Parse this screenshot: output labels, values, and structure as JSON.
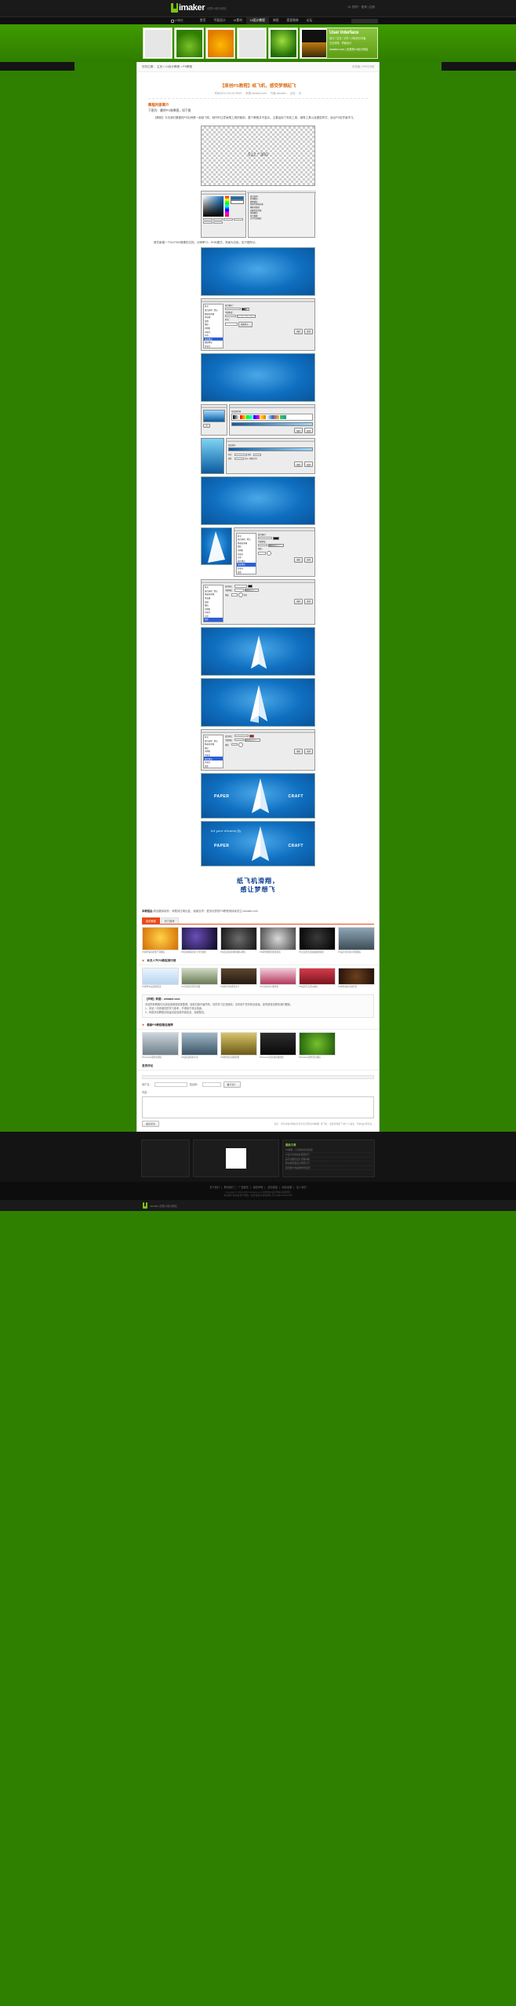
{
  "site": {
    "logo_word": "imaker",
    "logo_sub": "优秀UI设计网站",
    "top_right_greeting": "Hi, 您好！ 登录 | 注册"
  },
  "nav": {
    "home_label": "UI首页",
    "items": [
      {
        "label": "首页",
        "active": false
      },
      {
        "label": "平面设计",
        "active": false
      },
      {
        "label": "UI素材",
        "active": false
      },
      {
        "label": "UI设计教程",
        "active": true
      },
      {
        "label": "体验",
        "active": false
      },
      {
        "label": "家居装修",
        "active": false
      },
      {
        "label": "论坛",
        "active": false
      }
    ],
    "search_placeholder": "搜索"
  },
  "banner": {
    "thumbs": [
      {
        "name": "blank-thumb",
        "kind": "blank"
      },
      {
        "name": "leaf-thumb",
        "kind": "leaf"
      },
      {
        "name": "pepper-thumb",
        "kind": "pepper"
      },
      {
        "name": "blank2-thumb",
        "kind": "blank"
      },
      {
        "name": "apple-thumb",
        "kind": "apple"
      },
      {
        "name": "city-thumb",
        "kind": "city"
      }
    ],
    "promo": {
      "title": "User Interface",
      "desc": "设计 / 交互 / 分享 • UI知识分享者",
      "site": "uimaker.com | 优秀的UI设计网站",
      "sub": "交互体验 · 界面设计"
    }
  },
  "breadcrumb": {
    "prefix": "您的位置：",
    "items": [
      "主页",
      "UI设计教程",
      "PS教程"
    ],
    "right": "手机版 | RSS订阅"
  },
  "article": {
    "title": "【原创PS教程】纸飞机，感受梦想起飞",
    "meta_time": "时间:2012-03-16 09:52",
    "meta_source": "来源:uimaker.com",
    "meta_author": "作者:uimaker",
    "meta_views": "点击： 次",
    "section_head": "教程内容简介",
    "section_sub": "下图为：最终PS效果图，如下图",
    "paragraphs": [
      "【教程】今天我们要做的PS实例是一架纸飞机，制作时注意画笔工具的使用，整个教程并不复杂，主要运用了渐变工具、钢笔工具以及图层样式，适合PS初学者学习。",
      "首先新建一个512*300像素的文档，分辨率72，RGB模式，背景为白色，如下图所示。"
    ],
    "canvas_label": "512 * 300",
    "big_quote_line1": "纸飞机滑翔，",
    "big_quote_line2": "感让梦想飞"
  },
  "ps": {
    "dialog_titles": [
      "新建",
      "图层样式",
      "渐变编辑器",
      "渐变填充",
      "混合选项",
      "画笔预设"
    ],
    "style_list": [
      "样式",
      "混合选项：默认",
      "斜面和浮雕",
      "等高线",
      "纹理",
      "描边",
      "内阴影",
      "内发光",
      "光泽",
      "颜色叠加",
      "渐变叠加",
      "图案叠加",
      "外发光",
      "投影"
    ],
    "selected_style": "渐变叠加",
    "buttons": [
      "确定",
      "取消",
      "新建样式...",
      "预览"
    ],
    "labels": [
      "混合模式：",
      "不透明度：",
      "渐变：",
      "样式：",
      "角度：",
      "缩放：",
      "仿色",
      "反向",
      "与图层对齐"
    ]
  },
  "paper_text": {
    "left": "PAPER",
    "right": "CRAFT",
    "script": "let your dreams fly"
  },
  "after_article": {
    "tagline_prefix": "本教程由",
    "tagline_site": "uimaker.com",
    "tagline_text": "原创翻译制作，转载请注明出处，谢谢合作！更多优秀的PS教程请持续关注 uimaker.com",
    "tabs": [
      {
        "label": "相关教程",
        "on": true
      },
      {
        "label": "热门推荐",
        "on": false
      }
    ],
    "cards_row1": [
      {
        "caption": "PS制作逼真的热气球图标"
      },
      {
        "caption": "PS绘制绚丽的星空背景效果"
      },
      {
        "caption": "PS鼠绘质感的相机图标教程"
      },
      {
        "caption": "PS制作精致的金属钟表"
      },
      {
        "caption": "PS打造黑色质感播放器按钮"
      },
      {
        "caption": "PS设计简洁的UI界面图标"
      }
    ],
    "row2_title": "本月人气PS教程排行榜",
    "cards_row2": [
      {
        "caption": "PS制作水晶质感按钮"
      },
      {
        "caption": "PS合成创意风景海报"
      },
      {
        "caption": "PS制作立体折纸文字"
      },
      {
        "caption": "PS打造时尚人像调色"
      },
      {
        "caption": "PS绘制写实西瓜图标"
      },
      {
        "caption": "PS制作炫彩光效背景"
      }
    ],
    "note_head": "【声明】转载：uimaker.com",
    "note_body": "本站所有教程均为原创或网络收集整理，版权归原作者所有，仅供学习交流使用，请勿用于任何商业用途。如有侵权请联系我们删除。",
    "note_line1": "1、本站一切资源仅供学习参考，不得用于商业用途；",
    "note_line2": "2、转载本站教程请保留出处及原作者信息，谢谢配合。",
    "rec_title": "最新PS教程精选推荐",
    "cards_row3": [
      {
        "caption": "Photoshop制作@图标"
      },
      {
        "caption": "PS鼠绘逼真的小鱼"
      },
      {
        "caption": "PS制作复古海报效果"
      },
      {
        "caption": "Photoshop绘制质感播放器"
      },
      {
        "caption": "Photoshop制作西瓜图标"
      }
    ]
  },
  "comments": {
    "head_star": "★",
    "head": "发表评论",
    "nick_label": "用户名：",
    "nick_value": "",
    "code_label": "验证码：",
    "code_value": "",
    "code_btn": "看不清？",
    "content_label": "内容：",
    "content_value": "",
    "submit": "发表评论",
    "tip": "提示：评论内容为网友针对条目“【原创PS教程】纸飞机，感受梦想起飞”的个人看法，与本站立场无关。"
  },
  "footer": {
    "widget_title": "最新文章",
    "widget_items": [
      "PS教程：打造质感金属按钮",
      "UI设计中的色彩搭配技巧",
      "扁平化图标设计流程详解",
      "移动端界面设计规范分享",
      "如何用PS快速制作长投影"
    ],
    "links": [
      "关于我们",
      "联系我们",
      "广告服务",
      "版权声明",
      "友情链接",
      "网站地图",
      "加入我们"
    ],
    "copyright_line1": "Copyright © 2010-2012 uimaker.com 优秀的UI设计网站 版权所有",
    "copyright_line2": "本站部分素材来源于网络，如有侵权请来信告知 京ICP备12345678号",
    "bottom_text": "uimaker  优秀UI设计网站"
  }
}
